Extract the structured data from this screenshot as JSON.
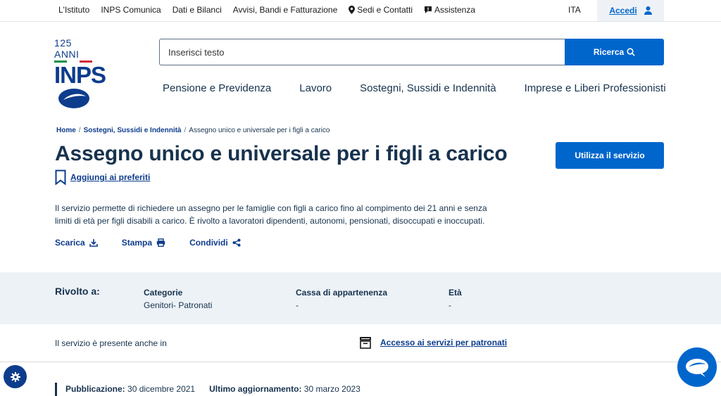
{
  "topbar": {
    "links": [
      {
        "label": "L'Istituto",
        "icon": ""
      },
      {
        "label": "INPS Comunica",
        "icon": ""
      },
      {
        "label": "Dati e Bilanci",
        "icon": ""
      },
      {
        "label": "Avvisi, Bandi e Fatturazione",
        "icon": ""
      },
      {
        "label": "Sedi e Contatti",
        "icon": "map-pin-icon"
      },
      {
        "label": "Assistenza",
        "icon": "chat-bubble-icon"
      }
    ],
    "language": "ITA",
    "login_label": "Accedi"
  },
  "logo": {
    "anniversary": "125 ANNI",
    "name": "INPS"
  },
  "search": {
    "placeholder": "Inserisci testo",
    "button_label": "Ricerca"
  },
  "main_nav": [
    "Pensione e Previdenza",
    "Lavoro",
    "Sostegni, Sussidi e Indennità",
    "Imprese e Liberi Professionisti"
  ],
  "breadcrumb": [
    {
      "label": "Home"
    },
    {
      "label": "Sostegni, Sussidi e Indennità"
    },
    {
      "label": "Assegno unico e universale per i figli a carico"
    }
  ],
  "page": {
    "title": "Assegno unico e universale per i figli a carico",
    "cta_label": "Utilizza il servizio",
    "favorite_label": "Aggiungi ai preferiti",
    "description": "Il servizio permette di richiedere un assegno per le famiglie con figli a carico fino al compimento dei 21 anni e senza limiti di età per figli disabili a carico. È rivolto a lavoratori dipendenti, autonomi, pensionati, disoccupati e inoccupati.",
    "actions": {
      "download": "Scarica",
      "print": "Stampa",
      "share": "Condividi"
    }
  },
  "audience": {
    "heading": "Rivolto a:",
    "categories": {
      "label": "Categorie",
      "value": "Genitori- Patronati"
    },
    "fund": {
      "label": "Cassa di appartenenza",
      "value": "-"
    },
    "age": {
      "label": "Età",
      "value": "-"
    }
  },
  "presence": {
    "label": "Il servizio è presente anche in",
    "link": "Accesso ai servizi per patronati"
  },
  "publication": {
    "published_label": "Pubblicazione:",
    "published_date": "30 dicembre 2021",
    "updated_label": "Ultimo aggiornamento:",
    "updated_date": "30 marzo 2023"
  },
  "colors": {
    "primary": "#0066cc",
    "dark_blue": "#0d3c8c",
    "text": "#17324d",
    "band": "#edf2f7"
  }
}
